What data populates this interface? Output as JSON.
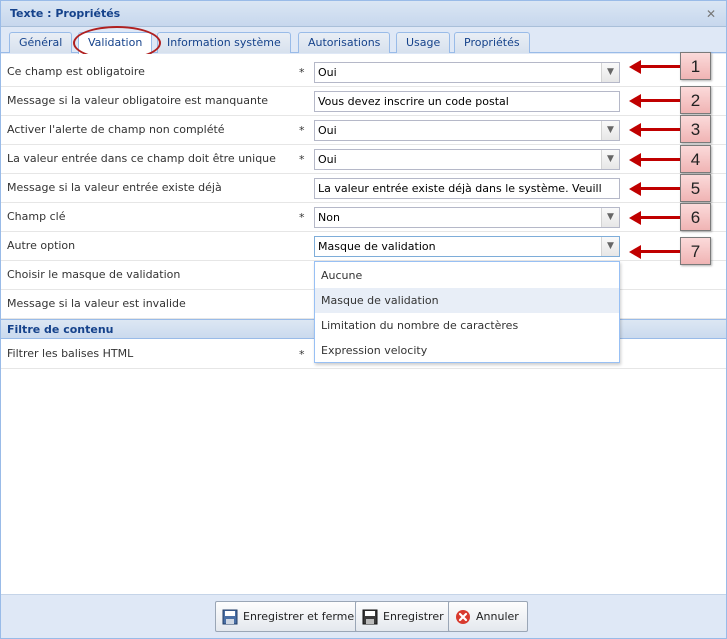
{
  "window": {
    "title": "Texte : Propriétés",
    "close_glyph": "✕"
  },
  "tabs": [
    {
      "label": "Général"
    },
    {
      "label": "Validation"
    },
    {
      "label": "Information système"
    },
    {
      "label": "Autorisations"
    },
    {
      "label": "Usage"
    },
    {
      "label": "Propriétés"
    }
  ],
  "active_tab": "Validation",
  "required_marker": "*",
  "fields": [
    {
      "label": "Ce champ est obligatoire",
      "required": true,
      "type": "combo",
      "value": "Oui"
    },
    {
      "label": "Message si la valeur obligatoire est manquante",
      "required": false,
      "type": "text",
      "value": "Vous devez inscrire un code postal"
    },
    {
      "label": "Activer l'alerte de champ non complété",
      "required": true,
      "type": "combo",
      "value": "Oui"
    },
    {
      "label": "La valeur entrée dans ce champ doit être unique",
      "required": true,
      "type": "combo",
      "value": "Oui"
    },
    {
      "label": "Message si la valeur entrée existe déjà",
      "required": false,
      "type": "text",
      "value": "La valeur entrée existe déjà  dans le système. Veuill"
    },
    {
      "label": "Champ clé",
      "required": true,
      "type": "combo",
      "value": "Non"
    },
    {
      "label": "Autre option",
      "required": false,
      "type": "combo",
      "value": "Masque de validation"
    },
    {
      "label": "Choisir le masque de validation",
      "required": false,
      "type": "hidden"
    },
    {
      "label": "Message si la valeur est invalide",
      "required": false,
      "type": "hidden"
    }
  ],
  "section": {
    "title": "Filtre de contenu",
    "fields": [
      {
        "label": "Filtrer les balises HTML",
        "required": true
      }
    ]
  },
  "dropdown": {
    "options": [
      "Aucune",
      "Masque de validation",
      "Limitation du nombre de caractères",
      "Expression velocity"
    ],
    "selected": "Masque de validation"
  },
  "annotations": [
    "1",
    "2",
    "3",
    "4",
    "5",
    "6",
    "7"
  ],
  "footer": {
    "save_close": "Enregistrer et fermer",
    "save": "Enregistrer",
    "cancel": "Annuler"
  },
  "colors": {
    "accent": "#15428b",
    "annotation_red": "#c00000",
    "header_bg": "#dfe8f6"
  },
  "icons": {
    "combo_trigger": "chevron-down-icon",
    "save_close": "save-close-icon",
    "save": "floppy-disk-icon",
    "cancel": "cancel-x-icon"
  }
}
